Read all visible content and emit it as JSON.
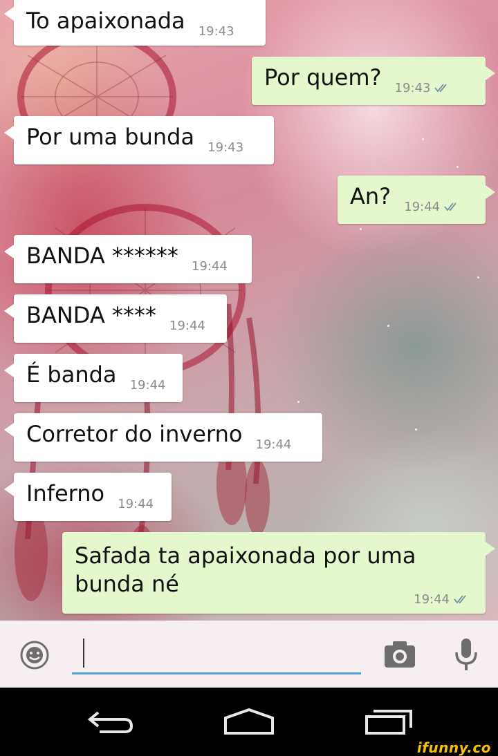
{
  "messages": [
    {
      "text": "To apaixonada",
      "time": "19:43",
      "direction": "in"
    },
    {
      "text": "Por quem?",
      "time": "19:43",
      "direction": "out",
      "status": "read"
    },
    {
      "text": "Por uma bunda",
      "time": "19:43",
      "direction": "in"
    },
    {
      "text": "An?",
      "time": "19:44",
      "direction": "out",
      "status": "read"
    },
    {
      "text": "BANDA ******",
      "time": "19:44",
      "direction": "in"
    },
    {
      "text": "BANDA ****",
      "time": "19:44",
      "direction": "in"
    },
    {
      "text": "É banda",
      "time": "19:44",
      "direction": "in"
    },
    {
      "text": "Corretor do inverno",
      "time": "19:44",
      "direction": "in"
    },
    {
      "text": "Inferno",
      "time": "19:44",
      "direction": "in"
    },
    {
      "text": "Safada ta apaixonada por uma bunda né",
      "time": "19:44",
      "direction": "out",
      "status": "read"
    }
  ],
  "input": {
    "value": ""
  },
  "icons": {
    "emoji": "smiley-icon",
    "camera": "camera-icon",
    "mic": "microphone-icon",
    "back": "back-arrow-icon",
    "home": "home-icon",
    "recents": "recent-apps-icon"
  },
  "colors": {
    "incoming_bubble": "#ffffff",
    "outgoing_bubble": "#e4f7cd",
    "input_underline": "#4ba0d6",
    "read_ticks": "#6f8fa0"
  },
  "watermark": "ifunny.co"
}
